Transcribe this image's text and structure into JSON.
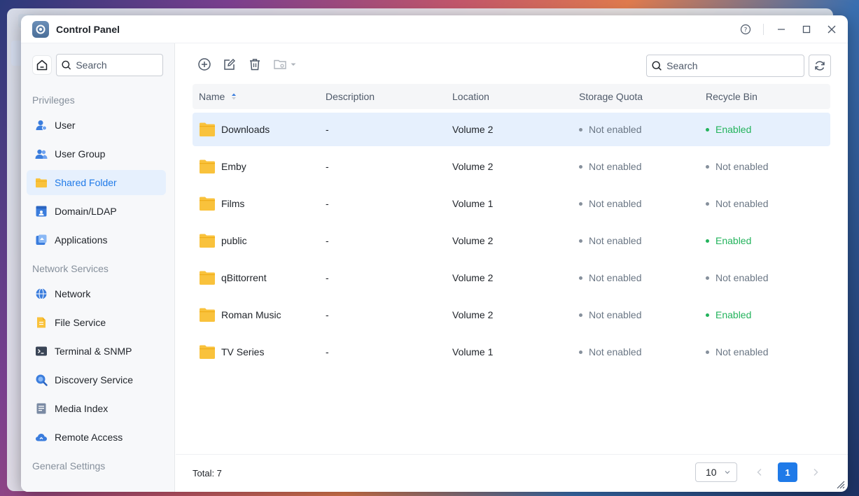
{
  "window": {
    "title": "Control Panel"
  },
  "sidebar": {
    "search_placeholder": "Search",
    "sections": [
      {
        "title": "Privileges",
        "items": [
          {
            "label": "User",
            "icon": "user-icon"
          },
          {
            "label": "User Group",
            "icon": "user-group-icon"
          },
          {
            "label": "Shared Folder",
            "icon": "shared-folder-icon",
            "active": true
          },
          {
            "label": "Domain/LDAP",
            "icon": "domain-icon"
          },
          {
            "label": "Applications",
            "icon": "applications-icon"
          }
        ]
      },
      {
        "title": "Network Services",
        "items": [
          {
            "label": "Network",
            "icon": "globe-icon"
          },
          {
            "label": "File Service",
            "icon": "file-service-icon"
          },
          {
            "label": "Terminal & SNMP",
            "icon": "terminal-icon"
          },
          {
            "label": "Discovery Service",
            "icon": "discovery-icon"
          },
          {
            "label": "Media Index",
            "icon": "media-index-icon"
          },
          {
            "label": "Remote Access",
            "icon": "cloud-icon"
          }
        ]
      },
      {
        "title": "General Settings",
        "items": []
      }
    ]
  },
  "toolbar": {
    "search_placeholder": "Search"
  },
  "table": {
    "columns": [
      "Name",
      "Description",
      "Location",
      "Storage Quota",
      "Recycle Bin"
    ],
    "rows": [
      {
        "name": "Downloads",
        "description": "-",
        "location": "Volume 2",
        "quota": "Not enabled",
        "recycle": "Enabled"
      },
      {
        "name": "Emby",
        "description": "-",
        "location": "Volume 2",
        "quota": "Not enabled",
        "recycle": "Not enabled"
      },
      {
        "name": "Films",
        "description": "-",
        "location": "Volume 1",
        "quota": "Not enabled",
        "recycle": "Not enabled"
      },
      {
        "name": "public",
        "description": "-",
        "location": "Volume 2",
        "quota": "Not enabled",
        "recycle": "Enabled"
      },
      {
        "name": "qBittorrent",
        "description": "-",
        "location": "Volume 2",
        "quota": "Not enabled",
        "recycle": "Not enabled"
      },
      {
        "name": "Roman Music",
        "description": "-",
        "location": "Volume 2",
        "quota": "Not enabled",
        "recycle": "Enabled"
      },
      {
        "name": "TV Series",
        "description": "-",
        "location": "Volume 1",
        "quota": "Not enabled",
        "recycle": "Not enabled"
      }
    ]
  },
  "footer": {
    "total": "Total: 7",
    "page_size": "10",
    "current_page": "1"
  },
  "colors": {
    "accent": "#1f7ae8",
    "enabled": "#23b35c",
    "folder": "#f9c23c"
  }
}
